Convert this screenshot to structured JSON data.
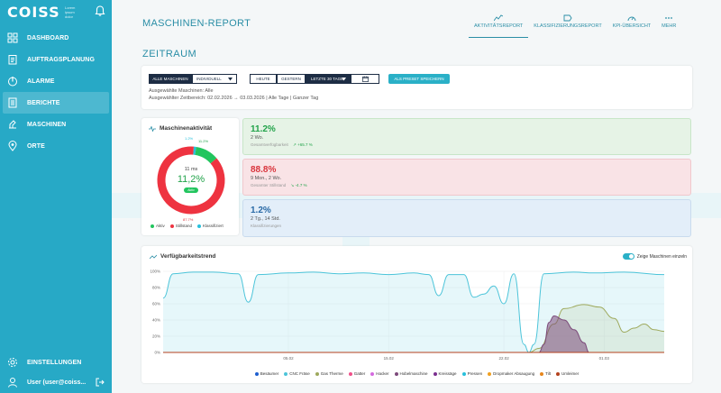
{
  "sidebar": {
    "logo": "COISS",
    "logo_sub": "Lorem ipsum dolor",
    "items": [
      {
        "label": "DASHBOARD",
        "icon": "dashboard-icon"
      },
      {
        "label": "AUFTRAGSPLANUNG",
        "icon": "clipboard-icon"
      },
      {
        "label": "ALARME",
        "icon": "alarm-icon"
      },
      {
        "label": "BERICHTE",
        "icon": "report-icon",
        "active": true
      },
      {
        "label": "MASCHINEN",
        "icon": "machine-icon"
      },
      {
        "label": "ORTE",
        "icon": "location-icon"
      }
    ],
    "settings_label": "EINSTELLUNGEN",
    "user_label": "User (user@coiss..."
  },
  "header": {
    "title": "MASCHINEN-REPORT",
    "tabs": [
      {
        "label": "AKTIVITÄTSREPORT",
        "icon": "activity-icon",
        "active": true
      },
      {
        "label": "KLASSIFIZIERUNGSREPORT",
        "icon": "tag-icon"
      },
      {
        "label": "KPI-ÜBERSICHT",
        "icon": "gauge-icon"
      },
      {
        "label": "MEHR",
        "icon": "more-icon"
      }
    ]
  },
  "section": {
    "title": "ZEITRAUM"
  },
  "filter": {
    "all_machines": "ALLE MASCHINEN",
    "individual": "INDIVIDUELL",
    "today": "HEUTE",
    "yesterday": "GESTERN",
    "last_days": "LETZTE 30 TAGE",
    "save_preset": "ALS PRESET SPEICHERN",
    "selected_machines": "Ausgewählte Maschinen: Alle",
    "selected_range": "Ausgewählter Zeitbereich: 02.02.2026 → 03.03.2026 | Alle Tage | Ganzer Tag"
  },
  "activity": {
    "title": "Maschinenaktivität",
    "center_time": "11 ms",
    "center_pct": "11,2%",
    "badge": "Aktiv",
    "label_top": "1.2%",
    "label_right": "11.2%",
    "label_bottom": "87.7%",
    "segments": [
      {
        "name": "Aktiv",
        "value": 11.2,
        "color": "#22c55e"
      },
      {
        "name": "Stillstand",
        "value": 87.7,
        "color": "#ee3340"
      },
      {
        "name": "Klassifiziert",
        "value": 1.2,
        "color": "#27c0dc"
      }
    ],
    "legend": [
      "Aktiv",
      "Stillstand",
      "Klassifiziert"
    ]
  },
  "stats": [
    {
      "value": "11.2%",
      "sub": "2 Wo.",
      "label": "Gesamtverfügbarkeit",
      "trend": "+65.7 %",
      "color": "#22a34a",
      "bg": "#e6f3e6",
      "border": "#c8e6c8"
    },
    {
      "value": "88.8%",
      "sub": "9 Mon., 2 Wo.",
      "label": "Gesamter Stillstand",
      "trend": "-4.7 %",
      "color": "#d9343c",
      "bg": "#f9e3e6",
      "border": "#f0c7cc"
    },
    {
      "value": "1.2%",
      "sub": "2 Tg., 14 Std.",
      "label": "Klassifizierungen",
      "trend": "",
      "color": "#2a6aa6",
      "bg": "#e3eef9",
      "border": "#c9dbee"
    }
  ],
  "trend": {
    "title": "Verfügbarkeitstrend",
    "toggle_label": "Zeige Maschinen einzeln"
  },
  "chart_data": {
    "type": "area",
    "ylabel": "",
    "ylim": [
      0,
      100
    ],
    "y_ticks": [
      "100%",
      "80%",
      "60%",
      "40%",
      "20%",
      "0%"
    ],
    "x_ticks": [
      "05.02",
      "15.02",
      "22.02",
      "01.03"
    ],
    "x_tick_pos": [
      0.25,
      0.45,
      0.68,
      0.88
    ],
    "grid": true,
    "series": [
      {
        "name": "CNC Fräse",
        "color": "#4cc4d9",
        "points": [
          [
            0,
            67
          ],
          [
            0.02,
            97
          ],
          [
            0.06,
            99
          ],
          [
            0.1,
            99
          ],
          [
            0.15,
            97
          ],
          [
            0.17,
            62
          ],
          [
            0.19,
            96
          ],
          [
            0.25,
            98
          ],
          [
            0.3,
            99
          ],
          [
            0.35,
            97
          ],
          [
            0.4,
            98
          ],
          [
            0.45,
            96
          ],
          [
            0.5,
            98
          ],
          [
            0.53,
            96
          ],
          [
            0.55,
            70
          ],
          [
            0.57,
            96
          ],
          [
            0.6,
            96
          ],
          [
            0.62,
            68
          ],
          [
            0.64,
            72
          ],
          [
            0.66,
            82
          ],
          [
            0.68,
            60
          ],
          [
            0.7,
            97
          ],
          [
            0.72,
            10
          ],
          [
            0.73,
            0
          ],
          [
            0.74,
            10
          ],
          [
            0.76,
            97
          ],
          [
            0.82,
            99
          ],
          [
            0.86,
            98
          ],
          [
            0.92,
            99
          ],
          [
            1,
            96
          ]
        ]
      },
      {
        "name": "Gas Therme",
        "color": "#9ea95c",
        "points": [
          [
            0,
            0
          ],
          [
            0.73,
            0
          ],
          [
            0.75,
            5
          ],
          [
            0.78,
            35
          ],
          [
            0.8,
            54
          ],
          [
            0.84,
            59
          ],
          [
            0.87,
            56
          ],
          [
            0.9,
            42
          ],
          [
            0.92,
            25
          ],
          [
            0.94,
            30
          ],
          [
            0.96,
            35
          ],
          [
            0.98,
            28
          ],
          [
            1,
            26
          ]
        ]
      },
      {
        "name": "Hobelmaschine",
        "color": "#7c4a7a",
        "points": [
          [
            0,
            0
          ],
          [
            0.75,
            0
          ],
          [
            0.76,
            10
          ],
          [
            0.77,
            37
          ],
          [
            0.78,
            45
          ],
          [
            0.8,
            40
          ],
          [
            0.82,
            28
          ],
          [
            0.84,
            12
          ],
          [
            0.85,
            0
          ],
          [
            1,
            0
          ]
        ]
      },
      {
        "name": "Umleimer",
        "color": "#b4421e",
        "points": [
          [
            0,
            0
          ],
          [
            1,
            0
          ]
        ]
      }
    ],
    "legend": [
      {
        "name": "Besäumer",
        "color": "#1e5fcf"
      },
      {
        "name": "CNC Fräse",
        "color": "#4cc4d9"
      },
      {
        "name": "Gas Therme",
        "color": "#9ea95c"
      },
      {
        "name": "Gatter",
        "color": "#f0508a"
      },
      {
        "name": "Hacker",
        "color": "#d46adf"
      },
      {
        "name": "Hobelmaschine",
        "color": "#7c4a7a"
      },
      {
        "name": "Kreissäge",
        "color": "#7a2e8e"
      },
      {
        "name": "Pressen",
        "color": "#27c0dc"
      },
      {
        "name": "Dropmaker Absaugung",
        "color": "#f0a020"
      },
      {
        "name": "Tilt",
        "color": "#e7861c"
      },
      {
        "name": "Umleimer",
        "color": "#b4421e"
      }
    ]
  }
}
